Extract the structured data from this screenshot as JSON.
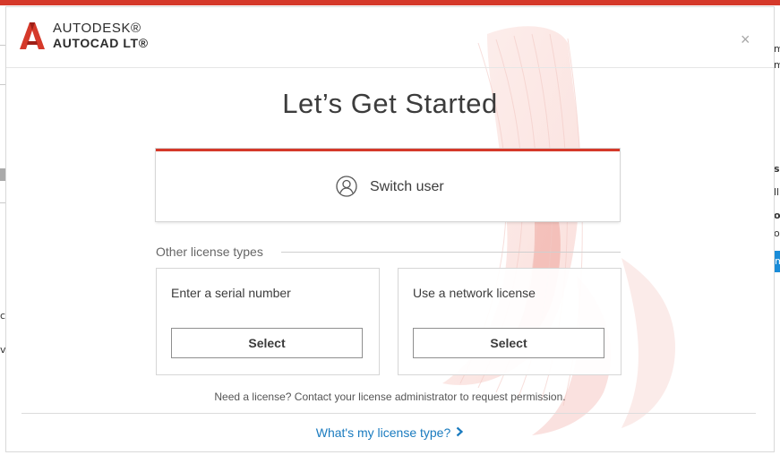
{
  "background": {
    "right_edge_glyphs": [
      "m",
      "m",
      "s",
      "ll",
      "o",
      "o",
      "m"
    ],
    "left_edge_glyphs": [
      "c",
      "v"
    ]
  },
  "dialog": {
    "brand": {
      "company": "AUTODESK®",
      "product": "AUTOCAD LT®",
      "logo_icon": "autocad-a-logo",
      "logo_color": "#d5392a"
    },
    "close_icon": "close-icon",
    "close_glyph": "×",
    "title": "Let’s Get Started",
    "switch_user": {
      "icon": "user-circle-icon",
      "label": "Switch user",
      "accent_color": "#d5392a"
    },
    "other_license": {
      "heading": "Other license types",
      "options": [
        {
          "title": "Enter a serial number",
          "button": "Select"
        },
        {
          "title": "Use a network license",
          "button": "Select"
        }
      ]
    },
    "footer": {
      "note": "Need a license? Contact your license administrator to request permission.",
      "link": "What's my license type?",
      "link_icon": "chevron-right-icon",
      "link_color": "#1a7bbf"
    }
  }
}
